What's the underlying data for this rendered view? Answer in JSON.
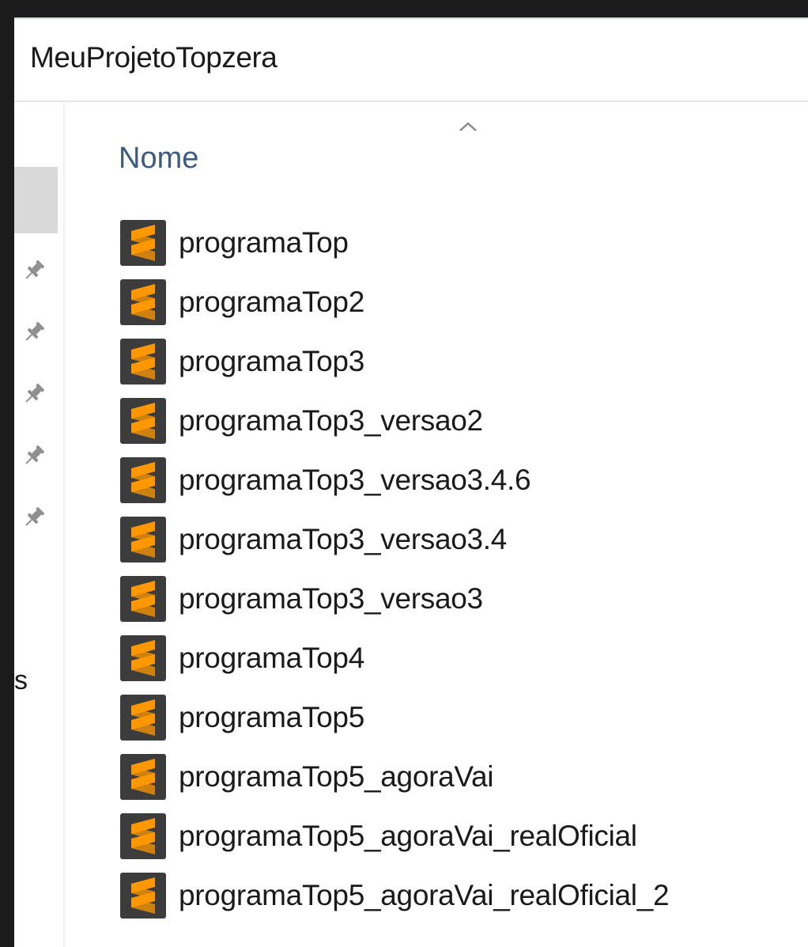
{
  "window": {
    "address_path": "MeuProjetoTopzera"
  },
  "nav_pane": {
    "pinned_count": 5,
    "truncated_label": "s",
    "pin_icon": "pin-icon"
  },
  "file_list": {
    "sort_indicator": "chevron-up-icon",
    "column_header": "Nome",
    "file_icon": "sublime-text-file-icon",
    "icon_colors": {
      "background": "#3c3c3c",
      "accent": "#ff9800"
    },
    "files": [
      {
        "name": "programaTop"
      },
      {
        "name": "programaTop2"
      },
      {
        "name": "programaTop3"
      },
      {
        "name": "programaTop3_versao2"
      },
      {
        "name": "programaTop3_versao3.4.6"
      },
      {
        "name": "programaTop3_versao3.4"
      },
      {
        "name": "programaTop3_versao3"
      },
      {
        "name": "programaTop4"
      },
      {
        "name": "programaTop5"
      },
      {
        "name": "programaTop5_agoraVai"
      },
      {
        "name": "programaTop5_agoraVai_realOficial"
      },
      {
        "name": "programaTop5_agoraVai_realOficial_2"
      }
    ]
  }
}
